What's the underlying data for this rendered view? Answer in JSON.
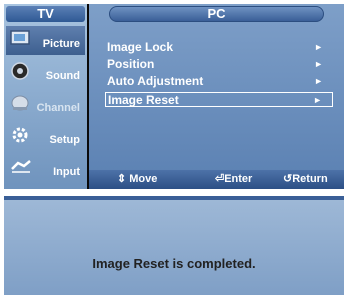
{
  "sidebar": {
    "title": "TV",
    "items": [
      {
        "label": "Picture",
        "icon": "picture-icon"
      },
      {
        "label": "Sound",
        "icon": "sound-icon"
      },
      {
        "label": "Channel",
        "icon": "channel-icon"
      },
      {
        "label": "Setup",
        "icon": "setup-icon"
      },
      {
        "label": "Input",
        "icon": "input-icon"
      }
    ]
  },
  "main": {
    "title": "PC",
    "items": [
      {
        "label": "Image Lock",
        "arrow": "►"
      },
      {
        "label": "Position",
        "arrow": "►"
      },
      {
        "label": "Auto Adjustment",
        "arrow": "►"
      },
      {
        "label": "Image Reset",
        "arrow": "►"
      }
    ]
  },
  "footer": {
    "move": "⇕ Move",
    "enter": "⏎Enter",
    "return": "↺Return"
  },
  "dialog": {
    "message": "Image Reset is completed."
  }
}
